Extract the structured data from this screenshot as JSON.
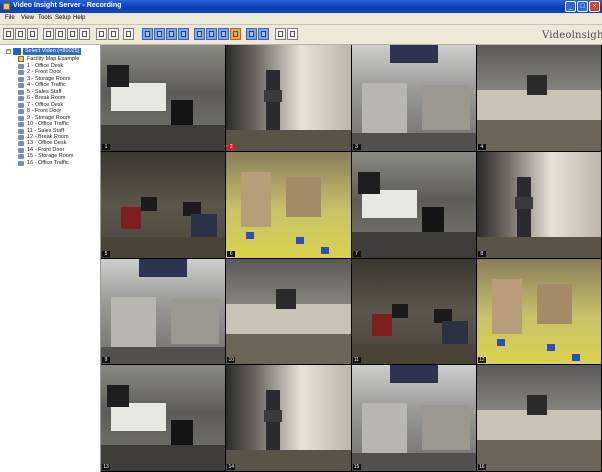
{
  "window": {
    "title": "Video Insight Server - Recording"
  },
  "menu": [
    "File",
    "View",
    "Tools",
    "Setup",
    "Help"
  ],
  "brand": "Videolnsight",
  "tree": {
    "root": "Select Video (=81025)",
    "map_item": "Facility Map Example",
    "items": [
      "1 - Office Desk",
      "2 - Front Door",
      "3 - Storage Room",
      "4 - Office Traffic",
      "5 - Sales Staff",
      "6 - Break Room",
      "7 - Office Desk",
      "8 - Front Door",
      "9 - Storage Room",
      "10 - Office Traffic",
      "11 - Sales Staff",
      "12 - Break Room",
      "13 - Office Desk",
      "14 - Front Door",
      "15 - Storage Room",
      "16 - Office Traffic"
    ]
  },
  "cameras": [
    "1",
    "2",
    "3",
    "4",
    "5",
    "6",
    "7",
    "8",
    "9",
    "10",
    "11",
    "12",
    "13",
    "14",
    "15",
    "16"
  ],
  "alarm_camera": "2",
  "icons": {
    "minimize": "minimize-icon",
    "maximize": "maximize-icon",
    "close": "close-icon"
  }
}
